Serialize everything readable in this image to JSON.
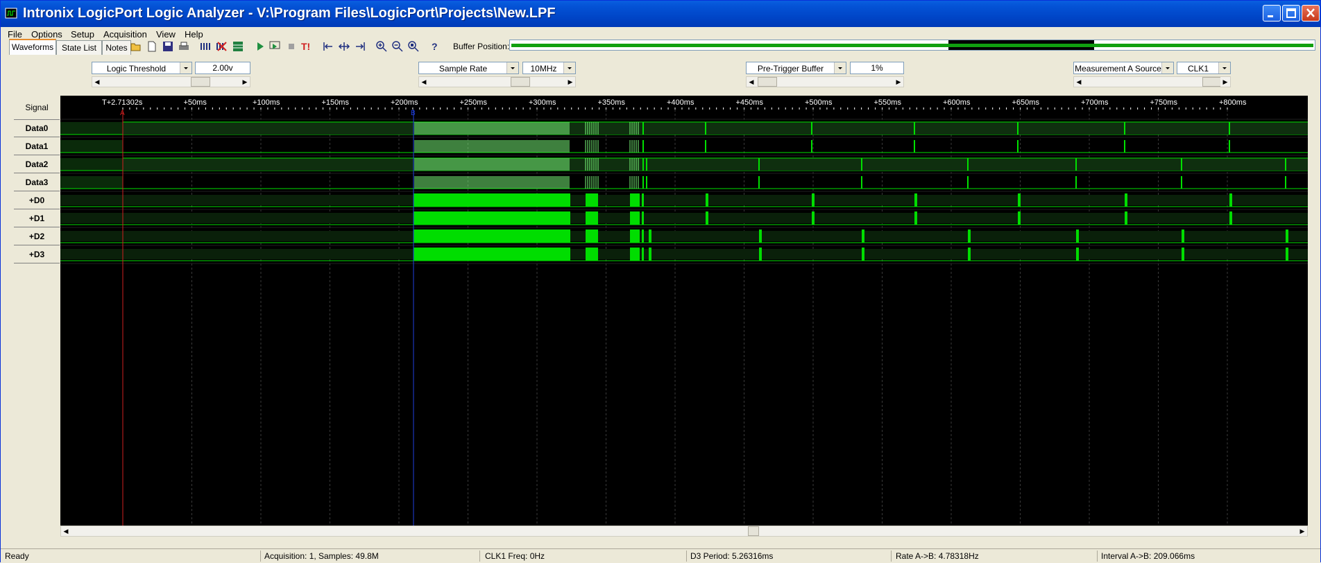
{
  "window": {
    "title": "Intronix LogicPort Logic Analyzer - V:\\Program Files\\LogicPort\\Projects\\New.LPF"
  },
  "menu": [
    "File",
    "Options",
    "Setup",
    "Acquisition",
    "View",
    "Help"
  ],
  "tabs": [
    "Waveforms",
    "State List",
    "Notes"
  ],
  "toolbar": {
    "buffer_label": "Buffer Position:",
    "icons": [
      "open-icon",
      "new-icon",
      "save-icon",
      "print-icon",
      "signal-add-icon",
      "signal-delete-icon",
      "grid-icon",
      "run-icon",
      "run-trigger-icon",
      "stop-icon",
      "force-trigger-icon",
      "cursor-left-icon",
      "cursor-center-icon",
      "cursor-right-icon",
      "zoom-in-icon",
      "zoom-out-icon",
      "zoom-fit-icon",
      "help-icon"
    ]
  },
  "controls": {
    "logic_threshold": {
      "label": "Logic Threshold",
      "value": "2.00v"
    },
    "sample_rate": {
      "label": "Sample Rate",
      "value": "10MHz"
    },
    "pretrigger": {
      "label": "Pre-Trigger Buffer",
      "value": "1%"
    },
    "measurement": {
      "label": "Measurement A Source",
      "value": "CLK1"
    }
  },
  "waveform": {
    "signal_header": "Signal",
    "signals": [
      "Data0",
      "Data1",
      "Data2",
      "Data3",
      "+D0",
      "+D1",
      "+D2",
      "+D3"
    ],
    "time_origin": "T+2.71302s",
    "ticks": [
      "+50ms",
      "+100ms",
      "+150ms",
      "+200ms",
      "+250ms",
      "+300ms",
      "+350ms",
      "+400ms",
      "+450ms",
      "+500ms",
      "+550ms",
      "+600ms",
      "+650ms",
      "+700ms",
      "+750ms",
      "+800ms"
    ],
    "marker_a": "A",
    "marker_b": "B",
    "colors": {
      "trace": "#00e000",
      "grid": "#3a3a3a",
      "marker_a": "#d02020",
      "marker_b": "#2020d0"
    }
  },
  "status": {
    "ready": "Ready",
    "acquisition": "Acquisition: 1, Samples: 49.8M",
    "clk_freq": "CLK1 Freq: 0Hz",
    "period": "D3 Period: 5.26316ms",
    "rate": "Rate A->B: 4.78318Hz",
    "interval": "Interval A->B: 209.066ms"
  }
}
